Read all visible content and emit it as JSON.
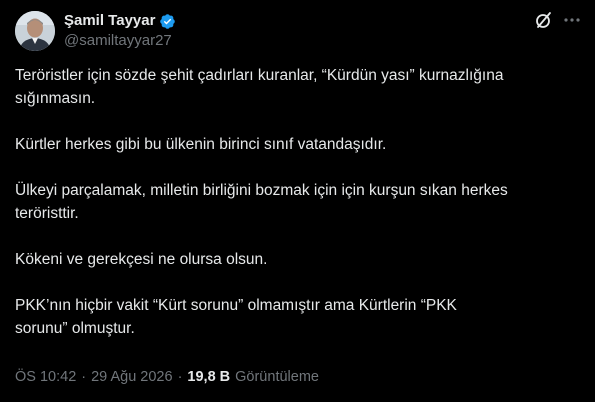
{
  "author": {
    "display_name": "Şamil Tayyar",
    "handle": "@samiltayyar27",
    "verified": true,
    "verified_color": "#1d9bf0"
  },
  "actions": {
    "grok_icon": "grok-icon",
    "more_icon": "more-icon"
  },
  "tweet": {
    "paragraphs": [
      "Teröristler için sözde şehit çadırları kuranlar, “Kürdün yası” kurnazlığına\nsığınmasın.",
      "Kürtler herkes gibi bu ülkenin birinci sınıf vatandaşıdır.",
      "Ülkeyi parçalamak, milletin birliğini bozmak için için kurşun sıkan herkes\nteröristtir.",
      "Kökeni ve gerekçesi ne olursa olsun.",
      "PKK’nın hiçbir vakit “Kürt sorunu” olmamıştır ama Kürtlerin “PKK\nsorunu” olmuştur."
    ]
  },
  "meta": {
    "time": "ÖS 10:42",
    "separator": "·",
    "date": "29 Ağu 2026",
    "views_count": "19,8 B",
    "views_label": "Görüntüleme"
  }
}
